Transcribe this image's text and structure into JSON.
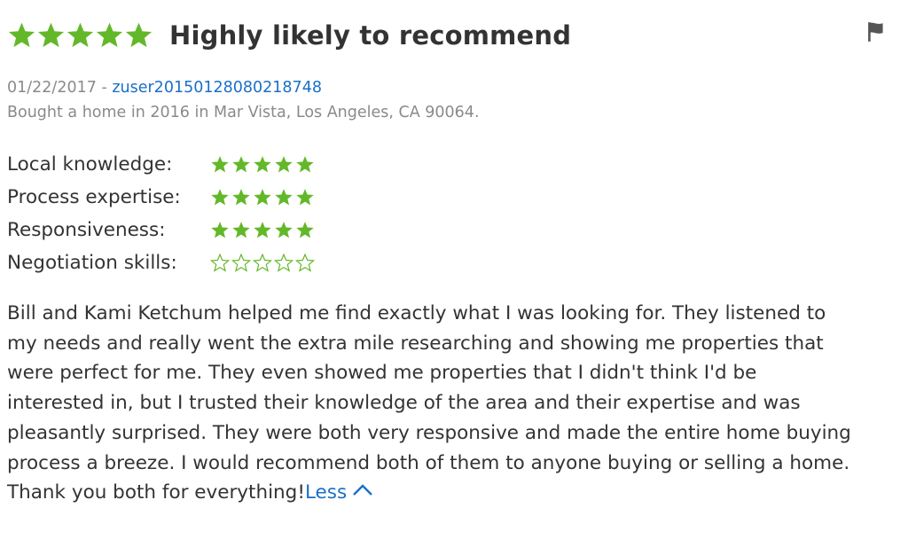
{
  "review": {
    "overall_stars": 5,
    "headline": "Highly likely to recommend",
    "date": "01/22/2017",
    "separator": " - ",
    "username": "zuser20150128080218748",
    "bought_info": "Bought a home in 2016 in Mar Vista, Los Angeles, CA 90064.",
    "ratings": [
      {
        "label": "Local knowledge:",
        "stars": 5
      },
      {
        "label": "Process expertise:",
        "stars": 5
      },
      {
        "label": "Responsiveness:",
        "stars": 5
      },
      {
        "label": "Negotiation skills:",
        "stars": 0
      }
    ],
    "body_lines": [
      "Bill and Kami Ketchum helped me find exactly what I was looking for. They listened to",
      "my needs and really went the extra mile researching and showing me properties that",
      "were perfect for me. They even showed me properties that I didn't think I'd be",
      "interested in, but I trusted their knowledge of the area and their expertise and was",
      "pleasantly surprised. They were both very responsive and made the entire home buying",
      "process a breeze. I would recommend both of them to anyone buying or selling a home.",
      "Thank you both for everything!"
    ],
    "less_label": "Less"
  },
  "icons": {
    "star": "star-icon",
    "flag": "flag-icon",
    "chevron": "chevron-up-icon"
  },
  "colors": {
    "star_green": "#63b829",
    "link_blue": "#1a6fc9",
    "meta_gray": "#8a8a8a",
    "text": "#333333"
  }
}
